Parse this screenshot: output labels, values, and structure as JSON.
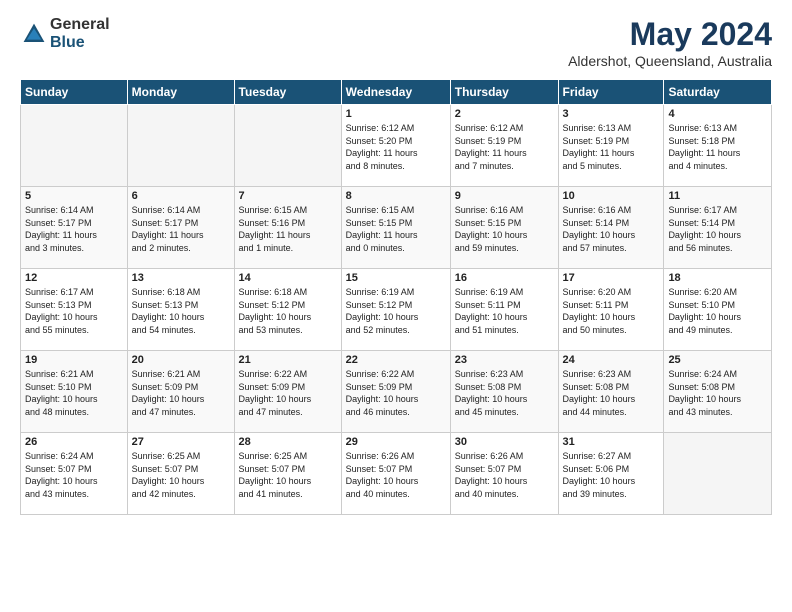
{
  "header": {
    "logo": {
      "general": "General",
      "blue": "Blue"
    },
    "title": "May 2024",
    "location": "Aldershot, Queensland, Australia"
  },
  "weekdays": [
    "Sunday",
    "Monday",
    "Tuesday",
    "Wednesday",
    "Thursday",
    "Friday",
    "Saturday"
  ],
  "weeks": [
    [
      {
        "day": "",
        "info": ""
      },
      {
        "day": "",
        "info": ""
      },
      {
        "day": "",
        "info": ""
      },
      {
        "day": "1",
        "info": "Sunrise: 6:12 AM\nSunset: 5:20 PM\nDaylight: 11 hours\nand 8 minutes."
      },
      {
        "day": "2",
        "info": "Sunrise: 6:12 AM\nSunset: 5:19 PM\nDaylight: 11 hours\nand 7 minutes."
      },
      {
        "day": "3",
        "info": "Sunrise: 6:13 AM\nSunset: 5:19 PM\nDaylight: 11 hours\nand 5 minutes."
      },
      {
        "day": "4",
        "info": "Sunrise: 6:13 AM\nSunset: 5:18 PM\nDaylight: 11 hours\nand 4 minutes."
      }
    ],
    [
      {
        "day": "5",
        "info": "Sunrise: 6:14 AM\nSunset: 5:17 PM\nDaylight: 11 hours\nand 3 minutes."
      },
      {
        "day": "6",
        "info": "Sunrise: 6:14 AM\nSunset: 5:17 PM\nDaylight: 11 hours\nand 2 minutes."
      },
      {
        "day": "7",
        "info": "Sunrise: 6:15 AM\nSunset: 5:16 PM\nDaylight: 11 hours\nand 1 minute."
      },
      {
        "day": "8",
        "info": "Sunrise: 6:15 AM\nSunset: 5:15 PM\nDaylight: 11 hours\nand 0 minutes."
      },
      {
        "day": "9",
        "info": "Sunrise: 6:16 AM\nSunset: 5:15 PM\nDaylight: 10 hours\nand 59 minutes."
      },
      {
        "day": "10",
        "info": "Sunrise: 6:16 AM\nSunset: 5:14 PM\nDaylight: 10 hours\nand 57 minutes."
      },
      {
        "day": "11",
        "info": "Sunrise: 6:17 AM\nSunset: 5:14 PM\nDaylight: 10 hours\nand 56 minutes."
      }
    ],
    [
      {
        "day": "12",
        "info": "Sunrise: 6:17 AM\nSunset: 5:13 PM\nDaylight: 10 hours\nand 55 minutes."
      },
      {
        "day": "13",
        "info": "Sunrise: 6:18 AM\nSunset: 5:13 PM\nDaylight: 10 hours\nand 54 minutes."
      },
      {
        "day": "14",
        "info": "Sunrise: 6:18 AM\nSunset: 5:12 PM\nDaylight: 10 hours\nand 53 minutes."
      },
      {
        "day": "15",
        "info": "Sunrise: 6:19 AM\nSunset: 5:12 PM\nDaylight: 10 hours\nand 52 minutes."
      },
      {
        "day": "16",
        "info": "Sunrise: 6:19 AM\nSunset: 5:11 PM\nDaylight: 10 hours\nand 51 minutes."
      },
      {
        "day": "17",
        "info": "Sunrise: 6:20 AM\nSunset: 5:11 PM\nDaylight: 10 hours\nand 50 minutes."
      },
      {
        "day": "18",
        "info": "Sunrise: 6:20 AM\nSunset: 5:10 PM\nDaylight: 10 hours\nand 49 minutes."
      }
    ],
    [
      {
        "day": "19",
        "info": "Sunrise: 6:21 AM\nSunset: 5:10 PM\nDaylight: 10 hours\nand 48 minutes."
      },
      {
        "day": "20",
        "info": "Sunrise: 6:21 AM\nSunset: 5:09 PM\nDaylight: 10 hours\nand 47 minutes."
      },
      {
        "day": "21",
        "info": "Sunrise: 6:22 AM\nSunset: 5:09 PM\nDaylight: 10 hours\nand 47 minutes."
      },
      {
        "day": "22",
        "info": "Sunrise: 6:22 AM\nSunset: 5:09 PM\nDaylight: 10 hours\nand 46 minutes."
      },
      {
        "day": "23",
        "info": "Sunrise: 6:23 AM\nSunset: 5:08 PM\nDaylight: 10 hours\nand 45 minutes."
      },
      {
        "day": "24",
        "info": "Sunrise: 6:23 AM\nSunset: 5:08 PM\nDaylight: 10 hours\nand 44 minutes."
      },
      {
        "day": "25",
        "info": "Sunrise: 6:24 AM\nSunset: 5:08 PM\nDaylight: 10 hours\nand 43 minutes."
      }
    ],
    [
      {
        "day": "26",
        "info": "Sunrise: 6:24 AM\nSunset: 5:07 PM\nDaylight: 10 hours\nand 43 minutes."
      },
      {
        "day": "27",
        "info": "Sunrise: 6:25 AM\nSunset: 5:07 PM\nDaylight: 10 hours\nand 42 minutes."
      },
      {
        "day": "28",
        "info": "Sunrise: 6:25 AM\nSunset: 5:07 PM\nDaylight: 10 hours\nand 41 minutes."
      },
      {
        "day": "29",
        "info": "Sunrise: 6:26 AM\nSunset: 5:07 PM\nDaylight: 10 hours\nand 40 minutes."
      },
      {
        "day": "30",
        "info": "Sunrise: 6:26 AM\nSunset: 5:07 PM\nDaylight: 10 hours\nand 40 minutes."
      },
      {
        "day": "31",
        "info": "Sunrise: 6:27 AM\nSunset: 5:06 PM\nDaylight: 10 hours\nand 39 minutes."
      },
      {
        "day": "",
        "info": ""
      }
    ]
  ]
}
